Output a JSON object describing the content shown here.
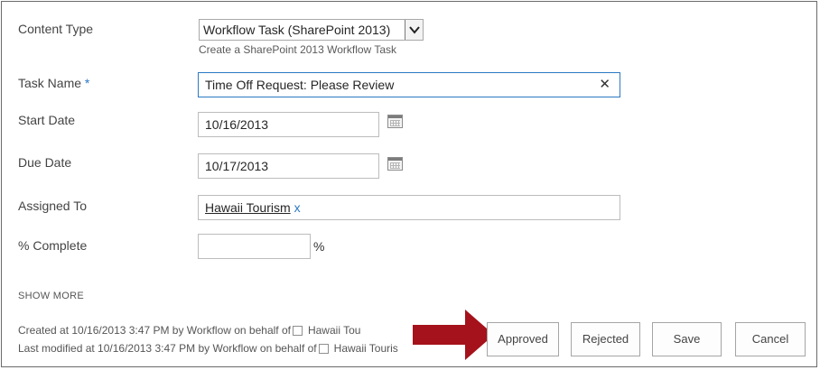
{
  "fields": {
    "content_type": {
      "label": "Content Type",
      "value": "Workflow Task (SharePoint 2013)",
      "description": "Create a SharePoint 2013 Workflow Task"
    },
    "task_name": {
      "label": "Task Name",
      "required_marker": "*",
      "value": "Time Off Request: Please Review",
      "clear_glyph": "✕"
    },
    "start_date": {
      "label": "Start Date",
      "value": "10/16/2013"
    },
    "due_date": {
      "label": "Due Date",
      "value": "10/17/2013"
    },
    "assigned_to": {
      "label": "Assigned To",
      "person": "Hawaii Tourism",
      "remove_glyph": "x"
    },
    "percent_complete": {
      "label": "% Complete",
      "value": "",
      "suffix": "%"
    }
  },
  "show_more": "SHOW MORE",
  "meta": {
    "created": {
      "prefix": "Created at 10/16/2013 3:47 PM  by Workflow on behalf of",
      "name": "Hawaii Tou"
    },
    "modified": {
      "prefix": "Last modified at 10/16/2013 3:47 PM  by Workflow on behalf of",
      "name": "Hawaii Touris"
    }
  },
  "buttons": {
    "approved": "Approved",
    "rejected": "Rejected",
    "save": "Save",
    "cancel": "Cancel"
  },
  "colors": {
    "accent": "#2b79c2",
    "arrow": "#a5121b"
  },
  "icons": {
    "date_picker": "calendar-icon",
    "dropdown": "chevron-down-icon",
    "callout": "red-arrow-icon"
  }
}
